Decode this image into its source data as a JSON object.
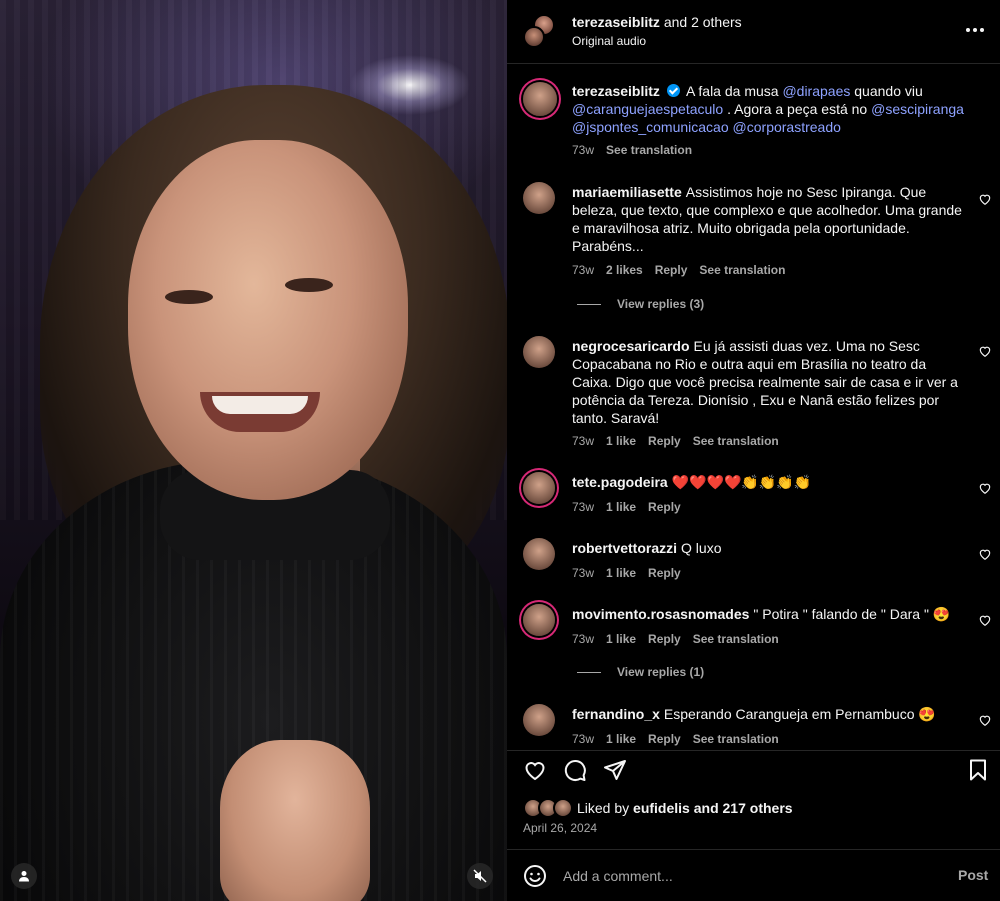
{
  "header": {
    "username": "terezaseiblitz",
    "with_others": "and 2 others",
    "subtitle": "Original audio"
  },
  "caption": {
    "username": "terezaseiblitz",
    "text_1": "A fala da musa",
    "mention_1": "@dirapaes",
    "text_2": "quando viu",
    "mention_2": "@caranguejaespetaculo",
    "text_3": ". Agora a peça está no",
    "mention_3": "@sescipiranga",
    "mention_4": "@jspontes_comunicacao",
    "mention_5": "@corporastreado",
    "time": "73w",
    "translate": "See translation"
  },
  "comments": [
    {
      "username": "mariaemiliasette",
      "text": "Assistimos hoje no Sesc Ipiranga. Que beleza, que texto, que complexo e que acolhedor. Uma grande e maravilhosa atriz. Muito obrigada pela oportunidade. Parabéns...",
      "time": "73w",
      "likes": "2 likes",
      "reply": "Reply",
      "translate": "See translation",
      "view_replies": "View replies (3)"
    },
    {
      "username": "negrocesaricardo",
      "text": "Eu já assisti duas vez. Uma no Sesc Copacabana no Rio e outra aqui em Brasília no teatro da Caixa. Digo que você precisa realmente sair de casa e ir ver a potência da Tereza. Dionísio , Exu e Nanã estão felizes por tanto. Saravá!",
      "time": "73w",
      "likes": "1 like",
      "reply": "Reply",
      "translate": "See translation"
    },
    {
      "username": "tete.pagodeira",
      "text": "❤️❤️❤️❤️👏👏👏👏",
      "time": "73w",
      "likes": "1 like",
      "reply": "Reply"
    },
    {
      "username": "robertvettorazzi",
      "text": "Q luxo",
      "time": "73w",
      "likes": "1 like",
      "reply": "Reply"
    },
    {
      "username": "movimento.rosasnomades",
      "text": "\" Potira \" falando de \" Dara \" 😍",
      "time": "73w",
      "likes": "1 like",
      "reply": "Reply",
      "translate": "See translation",
      "view_replies": "View replies (1)"
    },
    {
      "username": "fernandino_x",
      "text": "Esperando Carangueja em Pernambuco 😍",
      "time": "73w",
      "likes": "1 like",
      "reply": "Reply",
      "translate": "See translation"
    }
  ],
  "likes": {
    "prefix": "Liked by",
    "user": "eufidelis",
    "suffix": "and 217 others"
  },
  "date": "April 26, 2024",
  "add_comment": {
    "placeholder": "Add a comment...",
    "post_label": "Post"
  },
  "icons": {
    "like": "heart-icon",
    "comment": "comment-icon",
    "share": "send-icon",
    "save": "bookmark-icon",
    "emoji": "smile-icon",
    "options": "more-icon",
    "mute": "muted-speaker-icon",
    "tagged": "user-icon"
  },
  "colors": {
    "background": "#000000",
    "mention": "#8ea2ff",
    "muted_text": "#a8a8a8",
    "verified": "#0095f6"
  }
}
